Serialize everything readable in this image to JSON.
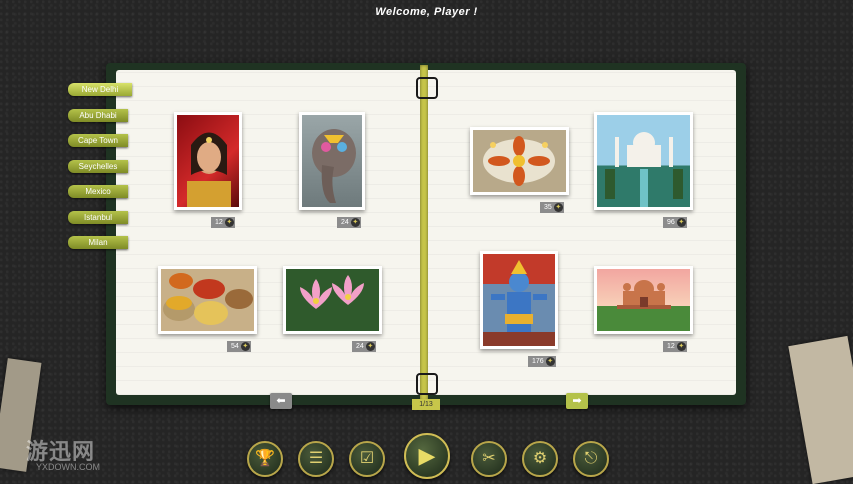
{
  "header": {
    "welcome": "Welcome, Player !"
  },
  "city_tabs": [
    {
      "label": "New Delhi",
      "active": true
    },
    {
      "label": "Abu Dhabi",
      "active": false
    },
    {
      "label": "Cape Town",
      "active": false
    },
    {
      "label": "Seychelles",
      "active": false
    },
    {
      "label": "Mexico",
      "active": false
    },
    {
      "label": "Istanbul",
      "active": false
    },
    {
      "label": "Milan",
      "active": false
    }
  ],
  "puzzles": [
    {
      "subject": "Indian woman in traditional jewelry",
      "pieces": "12"
    },
    {
      "subject": "Painted elephant",
      "pieces": "24"
    },
    {
      "subject": "Spices in bowls",
      "pieces": "54"
    },
    {
      "subject": "Pink lotus flowers",
      "pieces": "24"
    },
    {
      "subject": "Flower rangoli with candles",
      "pieces": "35"
    },
    {
      "subject": "Taj Mahal",
      "pieces": "96"
    },
    {
      "subject": "Hindu deity statue",
      "pieces": "176"
    },
    {
      "subject": "Mughal tomb with garden",
      "pieces": "12"
    }
  ],
  "pagination": {
    "page": "1/13",
    "prev_icon": "arrow-left-icon",
    "next_icon": "arrow-right-icon"
  },
  "toolbar": {
    "trophy": "trophy-icon",
    "list": "list-icon",
    "check": "checkbox-icon",
    "play": "play-icon",
    "scissors": "scissors-icon",
    "settings": "gear-icon",
    "exit": "exit-door-icon"
  },
  "watermark": {
    "main": "游迅网",
    "sub": "YXDOWN.COM"
  },
  "colors": {
    "accent": "#c7c64a",
    "book_cover": "#1f3322",
    "paper": "#f6f5ee"
  }
}
